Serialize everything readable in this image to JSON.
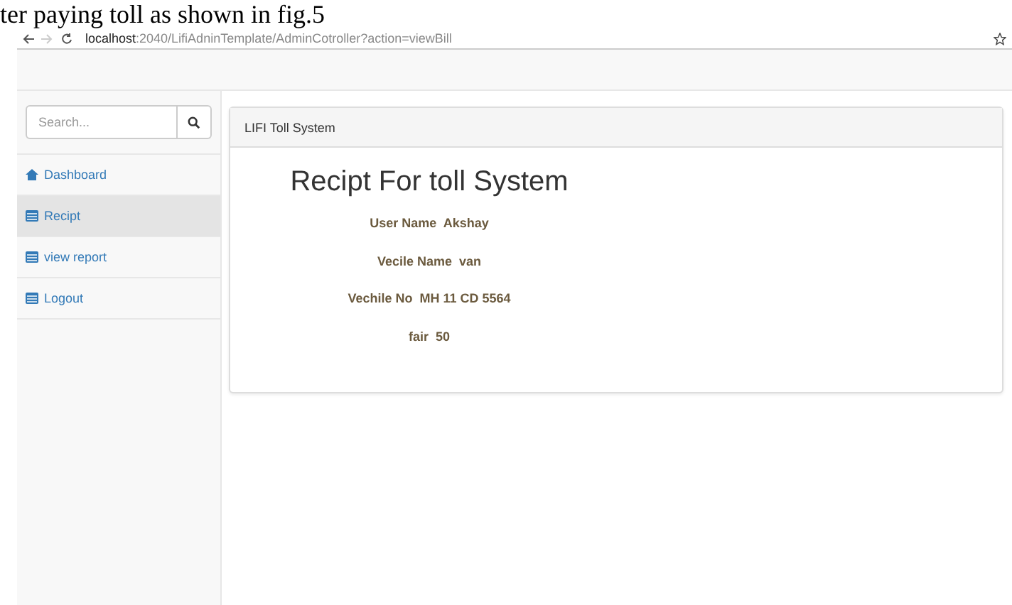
{
  "caption": "ter paying toll as shown in fig.5",
  "browser": {
    "url_host": "localhost",
    "url_rest": ":2040/LifiAdninTemplate/AdminCotroller?action=viewBill"
  },
  "search": {
    "placeholder": "Search..."
  },
  "sidebar": {
    "items": [
      {
        "label": "Dashboard",
        "kind": "dashboard",
        "selected": false
      },
      {
        "label": "Recipt",
        "kind": "list",
        "selected": true
      },
      {
        "label": "view report",
        "kind": "list",
        "selected": false
      },
      {
        "label": "Logout",
        "kind": "list",
        "selected": false
      }
    ]
  },
  "panel": {
    "heading": "LIFI Toll System",
    "title": "Recipt For toll System",
    "fields": [
      {
        "label": "User Name",
        "value": "Akshay"
      },
      {
        "label": "Vecile Name",
        "value": "van"
      },
      {
        "label": "Vechile No",
        "value": "MH 11 CD 5564"
      },
      {
        "label": "fair",
        "value": "50"
      }
    ]
  }
}
